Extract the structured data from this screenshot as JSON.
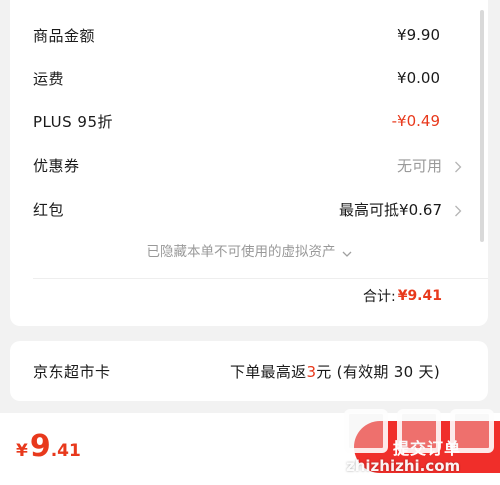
{
  "summary": {
    "rows": [
      {
        "label": "商品金额",
        "value": "¥9.90"
      },
      {
        "label": "运费",
        "value": "¥0.00"
      },
      {
        "label": "PLUS 95折",
        "value": "-¥0.49"
      },
      {
        "label": "优惠券",
        "value": "无可用"
      },
      {
        "label": "红包",
        "value": "最高可抵¥0.67"
      }
    ],
    "hidden_note": "已隐藏本单不可使用的虚拟资产",
    "total_label": "合计:",
    "total_amount": "¥9.41"
  },
  "market_card": {
    "label": "京东超市卡",
    "value_prefix": "下单最高返",
    "value_highlight": "3",
    "value_suffix": "元 (有效期 30 天)"
  },
  "footer": {
    "currency": "¥",
    "price_int": "9",
    "price_dec": ".41",
    "submit_label": "提交订单"
  },
  "watermark": {
    "site": "zhizhizhi.com"
  },
  "colors": {
    "accent": "#e8391c",
    "button": "#f02e2a",
    "muted": "#9a9a9a",
    "background": "#f2f2f2"
  }
}
